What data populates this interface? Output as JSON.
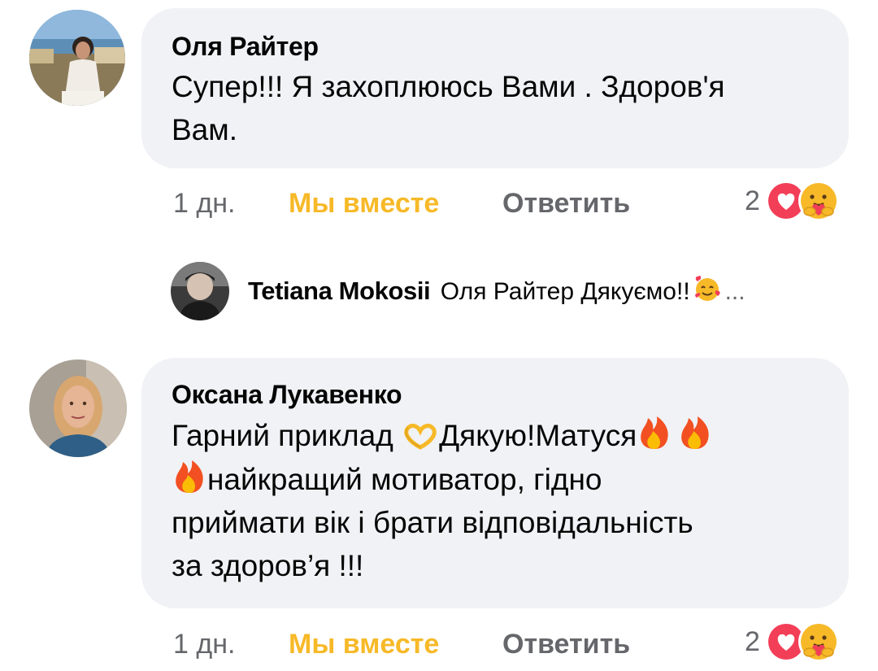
{
  "comments": [
    {
      "author": "Оля Райтер",
      "text_line1": "Супер!!! Я захоплююсь Вами . Здоров'я",
      "text_line2": "Вам.",
      "time": "1 дн.",
      "react_label": "Мы вместе",
      "reply_label": "Ответить",
      "reaction_count": "2",
      "reactions": [
        "love-icon",
        "care-icon"
      ]
    },
    {
      "author": "Оксана Лукавенко",
      "text_line1": "Гарний приклад",
      "text_line1b": "Дякую!Матуся",
      "text_line2": "найкращий мотиватор, гідно",
      "text_line3": "приймати вік і брати відповідальність",
      "text_line4": "за здоров’я !!!",
      "time": "1 дн.",
      "react_label": "Мы вместе",
      "reply_label": "Ответить",
      "reaction_count": "2",
      "reactions": [
        "love-icon",
        "care-icon"
      ]
    }
  ],
  "reply_preview": {
    "author": "Tetiana Mokosii",
    "text": "Оля Райтер Дякуємо!!",
    "ellipsis": "..."
  },
  "colors": {
    "bubble": "#f0f2f5",
    "meta_text": "#65676b",
    "react_accent": "#f7b928",
    "love_red": "#f33e58",
    "care_yellow": "#f7b928"
  }
}
